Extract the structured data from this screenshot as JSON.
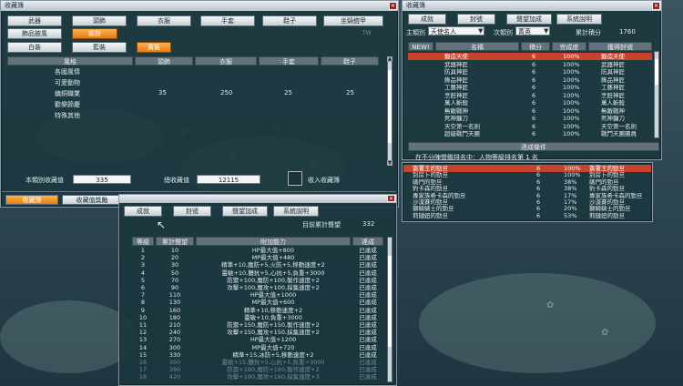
{
  "win1": {
    "title": "收藏簿",
    "category_tabs": [
      "武器",
      "頭飾",
      "衣服",
      "手套",
      "鞋子",
      "坐騎鎧甲"
    ],
    "category_tabs2": [
      "飾品披風",
      "裝扮"
    ],
    "sub_tabs": [
      "白裝",
      "藍裝",
      "黃裝"
    ],
    "table_headers": [
      "風格",
      "頭飾",
      "衣服",
      "手套",
      "鞋子"
    ],
    "styles": [
      "各國風情",
      "可愛動物",
      "鎮銅職業",
      "歡樂節慶",
      "特殊其他"
    ],
    "job_row_values": [
      "35",
      "250",
      "25",
      "25"
    ],
    "stats": {
      "this_category_label": "本類別收藏值",
      "this_category_value": "335",
      "total_label": "總收藏值",
      "total_value": "12115",
      "collect_label": "收入收藏簿"
    },
    "bottom_tabs": [
      "收藏簿",
      "收藏值獎勵"
    ]
  },
  "win2": {
    "title": "收藏簿",
    "tabs": [
      "成就",
      "封號",
      "聲望加成",
      "系統說明"
    ],
    "filter": {
      "main_label": "主類別",
      "main_value": "天使名人",
      "sub_label": "次類別",
      "sub_value": "菁英",
      "total_label": "累計積分",
      "total_value": "1760"
    },
    "headers": [
      "NEW!",
      "名稱",
      "積分",
      "完成度",
      "獲得封號"
    ],
    "rows": [
      {
        "name": "鍛造天使",
        "score": "6",
        "pct": "100%",
        "title": "鍛造天使"
      },
      {
        "name": "武器神匠",
        "score": "6",
        "pct": "100%",
        "title": "武器神匠"
      },
      {
        "name": "防具神匠",
        "score": "6",
        "pct": "100%",
        "title": "防具神匠"
      },
      {
        "name": "飾品神匠",
        "score": "6",
        "pct": "100%",
        "title": "飾品神匠"
      },
      {
        "name": "工藝神匠",
        "score": "6",
        "pct": "100%",
        "title": "工藝神匠"
      },
      {
        "name": "烹飪神匠",
        "score": "6",
        "pct": "100%",
        "title": "烹飪神匠"
      },
      {
        "name": "萬人斬殺",
        "score": "6",
        "pct": "100%",
        "title": "萬人斬殺"
      },
      {
        "name": "無敵戰神",
        "score": "6",
        "pct": "100%",
        "title": "無敵戰神"
      },
      {
        "name": "死神鐮刀",
        "score": "6",
        "pct": "100%",
        "title": "死神鐮刀"
      },
      {
        "name": "天空第一名劍",
        "score": "6",
        "pct": "100%",
        "title": "天空第一名劍"
      },
      {
        "name": "超級戰鬥天團",
        "score": "6",
        "pct": "100%",
        "title": "戰鬥天團團員"
      }
    ],
    "conditions_header": "達成條件",
    "condition_text": "在不分陣營鍛排名中：人物等級排名第 1 名",
    "rows2": [
      {
        "name": "簽署王的勁旦",
        "score": "6",
        "pct": "100%",
        "title": "簽署王的勁旦"
      },
      {
        "name": "別房卜的勁旦",
        "score": "6",
        "pct": "100%",
        "title": "別房卜的勁旦"
      },
      {
        "name": "碼門的勁旦",
        "score": "6",
        "pct": "38%",
        "title": "碼門的勁旦"
      },
      {
        "name": "豹卡森的勁旦",
        "score": "6",
        "pct": "38%",
        "title": "豹卡森的勁旦"
      },
      {
        "name": "專家族希卡森的勁旦",
        "score": "6",
        "pct": "17%",
        "title": "專家族希卡森的勁旦"
      },
      {
        "name": "沙漠賽的勁旦",
        "score": "6",
        "pct": "17%",
        "title": "沙漠賽的勁旦"
      },
      {
        "name": "獅騎騎士的勁旦",
        "score": "6",
        "pct": "20%",
        "title": "獅騎騎士的勁旦"
      },
      {
        "name": "莉鏈妞的勁旦",
        "score": "6",
        "pct": "53%",
        "title": "莉鏈妞的勁旦"
      }
    ]
  },
  "win3": {
    "tabs": [
      "成就",
      "封號",
      "聲望加成",
      "系統說明"
    ],
    "total_label": "目前累計聲望",
    "total_value": "332",
    "headers": [
      "等級",
      "累計聲望",
      "附加能力",
      "達成"
    ],
    "rows": [
      {
        "lvl": "1",
        "rep": "10",
        "bonus": "HP最大值+800",
        "status": "已達成"
      },
      {
        "lvl": "2",
        "rep": "20",
        "bonus": "MP最大值+480",
        "status": "已達成"
      },
      {
        "lvl": "3",
        "rep": "30",
        "bonus": "精準+10,魔防+5,火防+5,移動速度+2",
        "status": "已達成"
      },
      {
        "lvl": "4",
        "rep": "50",
        "bonus": "靈敏+10,體抗+5,心抗+5,負重+3000",
        "status": "已達成"
      },
      {
        "lvl": "5",
        "rep": "70",
        "bonus": "防禦+100,魔防+100,製作速度+2",
        "status": "已達成"
      },
      {
        "lvl": "6",
        "rep": "90",
        "bonus": "攻擊+100,魔攻+100,採集速度+2",
        "status": "已達成"
      },
      {
        "lvl": "7",
        "rep": "110",
        "bonus": "HP最大值+1000",
        "status": "已達成"
      },
      {
        "lvl": "8",
        "rep": "130",
        "bonus": "MP最大值+600",
        "status": "已達成"
      },
      {
        "lvl": "9",
        "rep": "160",
        "bonus": "精準+10,移動速度+2",
        "status": "已達成"
      },
      {
        "lvl": "10",
        "rep": "180",
        "bonus": "靈敏+10,負重+3000",
        "status": "已達成"
      },
      {
        "lvl": "11",
        "rep": "210",
        "bonus": "防禦+150,魔防+150,製作速度+2",
        "status": "已達成"
      },
      {
        "lvl": "12",
        "rep": "240",
        "bonus": "攻擊+150,魔攻+150,採集速度+2",
        "status": "已達成"
      },
      {
        "lvl": "13",
        "rep": "270",
        "bonus": "HP最大值+1200",
        "status": "已達成"
      },
      {
        "lvl": "14",
        "rep": "300",
        "bonus": "MP最大值+720",
        "status": "已達成"
      },
      {
        "lvl": "15",
        "rep": "330",
        "bonus": "精準+15,冰防+5,移動速度+2",
        "status": "已達成"
      },
      {
        "lvl": "16",
        "rep": "360",
        "bonus": "靈敏+15,體抗+5,心抗+5,負重+3000",
        "status": "已達成"
      },
      {
        "lvl": "17",
        "rep": "390",
        "bonus": "防禦+180,魔防+180,製作速度+2",
        "status": "已達成"
      },
      {
        "lvl": "18",
        "rep": "420",
        "bonus": "攻擊+180,魔攻+180,採集速度+3",
        "status": "已達成"
      }
    ]
  }
}
